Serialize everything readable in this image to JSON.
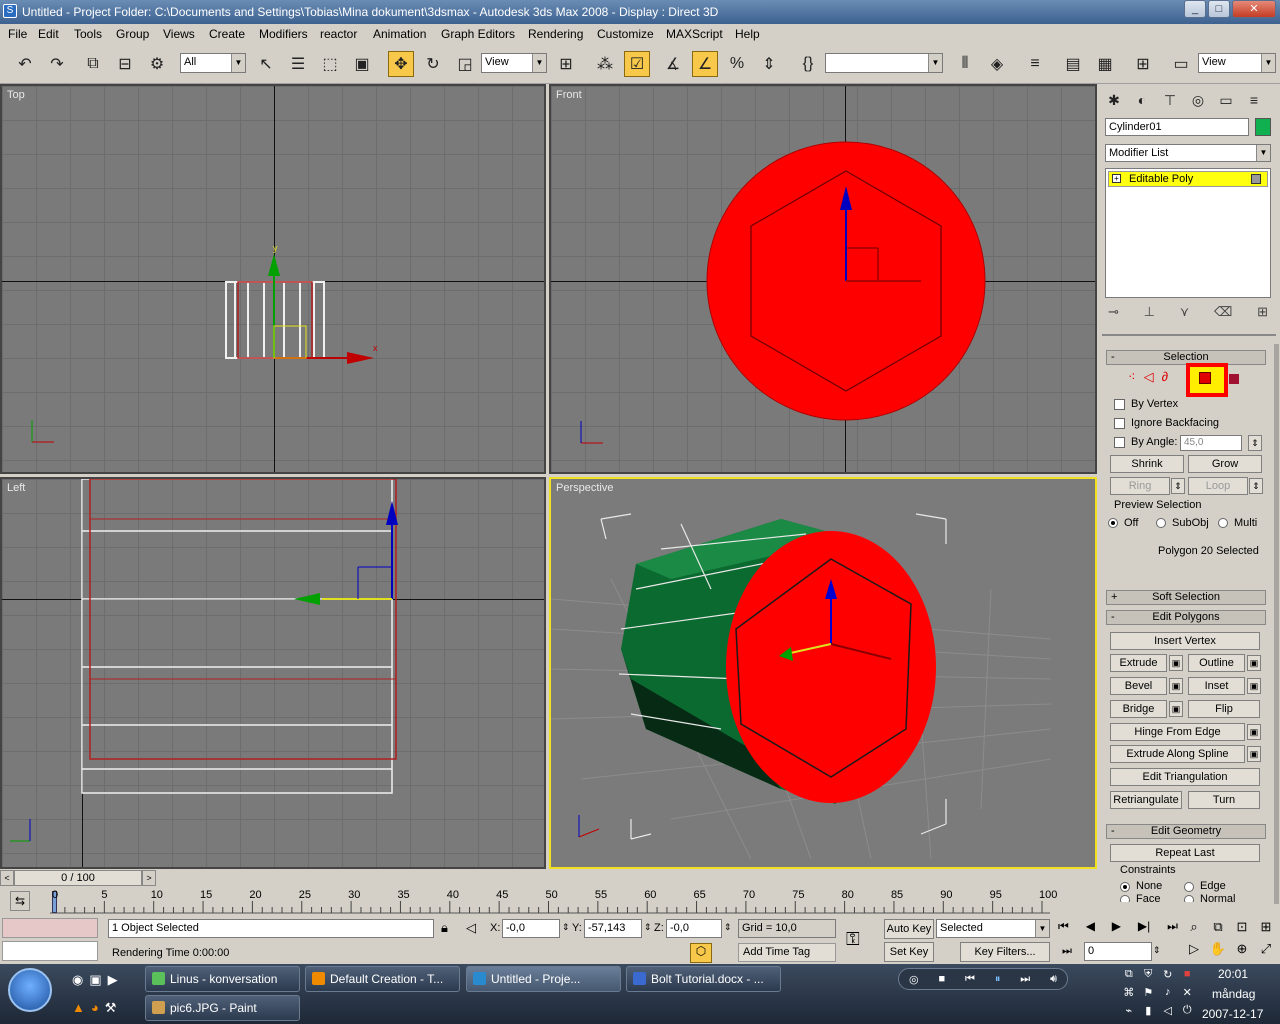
{
  "window": {
    "title": "Untitled      - Project Folder: C:\\Documents and Settings\\Tobias\\Mina dokument\\3dsmax      - Autodesk 3ds Max 2008      - Display : Direct 3D",
    "title_color": "#3d6190"
  },
  "menu": [
    "File",
    "Edit",
    "Tools",
    "Group",
    "Views",
    "Create",
    "Modifiers",
    "reactor",
    "Animation",
    "Graph Editors",
    "Rendering",
    "Customize",
    "MAXScript",
    "Help"
  ],
  "toolbar": {
    "selection_filter": "All",
    "ref_coord_system": "View",
    "named_selection": "",
    "view_dropdown": "View",
    "icons": [
      "undo-icon",
      "redo-icon",
      "link-icon",
      "unlink-icon",
      "bind-space-warp-icon",
      "select-icon",
      "select-by-name-icon",
      "rect-region-icon",
      "window-crossing-icon",
      "move-icon",
      "rotate-icon",
      "scale-icon",
      "pivot-icon",
      "mirror-icon",
      "snap-icon",
      "angle-snap-icon",
      "percent-snap-icon",
      "spinner-snap-icon",
      "named-sets-icon",
      "mirror-tool-icon",
      "align-icon",
      "layer-icon",
      "curve-editor-icon",
      "schematic-icon",
      "material-editor-icon",
      "render-setup-icon",
      "render-icon"
    ]
  },
  "viewports": {
    "top": {
      "label": "Top"
    },
    "front": {
      "label": "Front"
    },
    "left": {
      "label": "Left"
    },
    "perspective": {
      "label": "Perspective"
    },
    "axis_x": "x",
    "axis_y": "y",
    "axis_z": "z",
    "object_color": "#ff0000",
    "side_color": "#0a6a30",
    "active_color": "#f0e020"
  },
  "command_panel": {
    "object_name": "Cylinder01",
    "object_color": "#10b050",
    "modifier_list": "Modifier List",
    "stack_item": "Editable Poly",
    "selection": {
      "title": "Selection",
      "by_vertex": "By Vertex",
      "ignore_backfacing": "Ignore Backfacing",
      "by_angle": "By Angle:",
      "angle_value": "45,0",
      "shrink": "Shrink",
      "grow": "Grow",
      "ring": "Ring",
      "loop": "Loop",
      "preview_selection": "Preview Selection",
      "off": "Off",
      "subobj": "SubObj",
      "multi": "Multi",
      "status": "Polygon 20 Selected"
    },
    "soft_selection": "Soft Selection",
    "edit_polygons": {
      "title": "Edit Polygons",
      "insert_vertex": "Insert Vertex",
      "extrude": "Extrude",
      "outline": "Outline",
      "bevel": "Bevel",
      "inset": "Inset",
      "bridge": "Bridge",
      "flip": "Flip",
      "hinge_from_edge": "Hinge From Edge",
      "extrude_along_spline": "Extrude Along Spline",
      "edit_triangulation": "Edit Triangulation",
      "retriangulate": "Retriangulate",
      "turn": "Turn"
    },
    "edit_geometry": {
      "title": "Edit Geometry",
      "repeat_last": "Repeat Last",
      "constraints": "Constraints",
      "none": "None",
      "edge": "Edge",
      "face": "Face",
      "normal": "Normal"
    }
  },
  "timeline": {
    "slider_text": "0 / 100",
    "ticks": [
      "0",
      "5",
      "10",
      "15",
      "20",
      "25",
      "30",
      "35",
      "40",
      "45",
      "50",
      "55",
      "60",
      "65",
      "70",
      "75",
      "80",
      "85",
      "90",
      "95",
      "100"
    ]
  },
  "status": {
    "selected": "1 Object Selected",
    "prompt": "Rendering Time  0:00:00",
    "x_label": "X:",
    "x_value": "-0,0",
    "y_label": "Y:",
    "y_value": "-57,143",
    "z_label": "Z:",
    "z_value": "-0,0",
    "grid": "Grid = 10,0",
    "add_time_tag": "Add Time Tag",
    "auto_key": "Auto Key",
    "set_key": "Set Key",
    "key_mode": "Selected",
    "key_filters": "Key Filters...",
    "frame": "0"
  },
  "taskbar": {
    "row1": [
      {
        "label": "Linus - konversation"
      },
      {
        "label": "Default Creation - T..."
      },
      {
        "label": "Untitled       - Proje..."
      },
      {
        "label": "Bolt Tutorial.docx - ..."
      }
    ],
    "row2": [
      {
        "label": "pic6.JPG - Paint"
      }
    ],
    "time": "20:01",
    "day": "måndag",
    "date": "2007-12-17"
  }
}
